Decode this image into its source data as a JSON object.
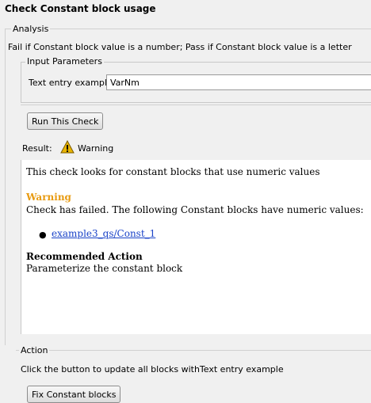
{
  "title": "Check Constant block usage",
  "analysis": {
    "label": "Analysis",
    "description": "Fail if Constant block value is a number; Pass if Constant block value is a letter",
    "input_parameters_label": "Input Parameters",
    "text_entry_label": "Text entry example",
    "text_entry_value": "VarNm",
    "run_button_label": "Run This Check",
    "result_label": "Result:",
    "result_status": "Warning",
    "result_status_color": "#e8b400"
  },
  "report": {
    "intro": "This check looks for constant blocks that use numeric values",
    "warning_heading": "Warning",
    "warning_heading_color": "#e89b12",
    "warning_text": "Check has failed. The following Constant blocks have numeric values:",
    "blocks": [
      "example3_qs/Const_1"
    ],
    "recommended_heading": "Recommended Action",
    "recommended_text": "Parameterize the constant block"
  },
  "action": {
    "label": "Action",
    "description": "Click the button to update all blocks withText entry example",
    "fix_button_label": "Fix Constant blocks"
  }
}
